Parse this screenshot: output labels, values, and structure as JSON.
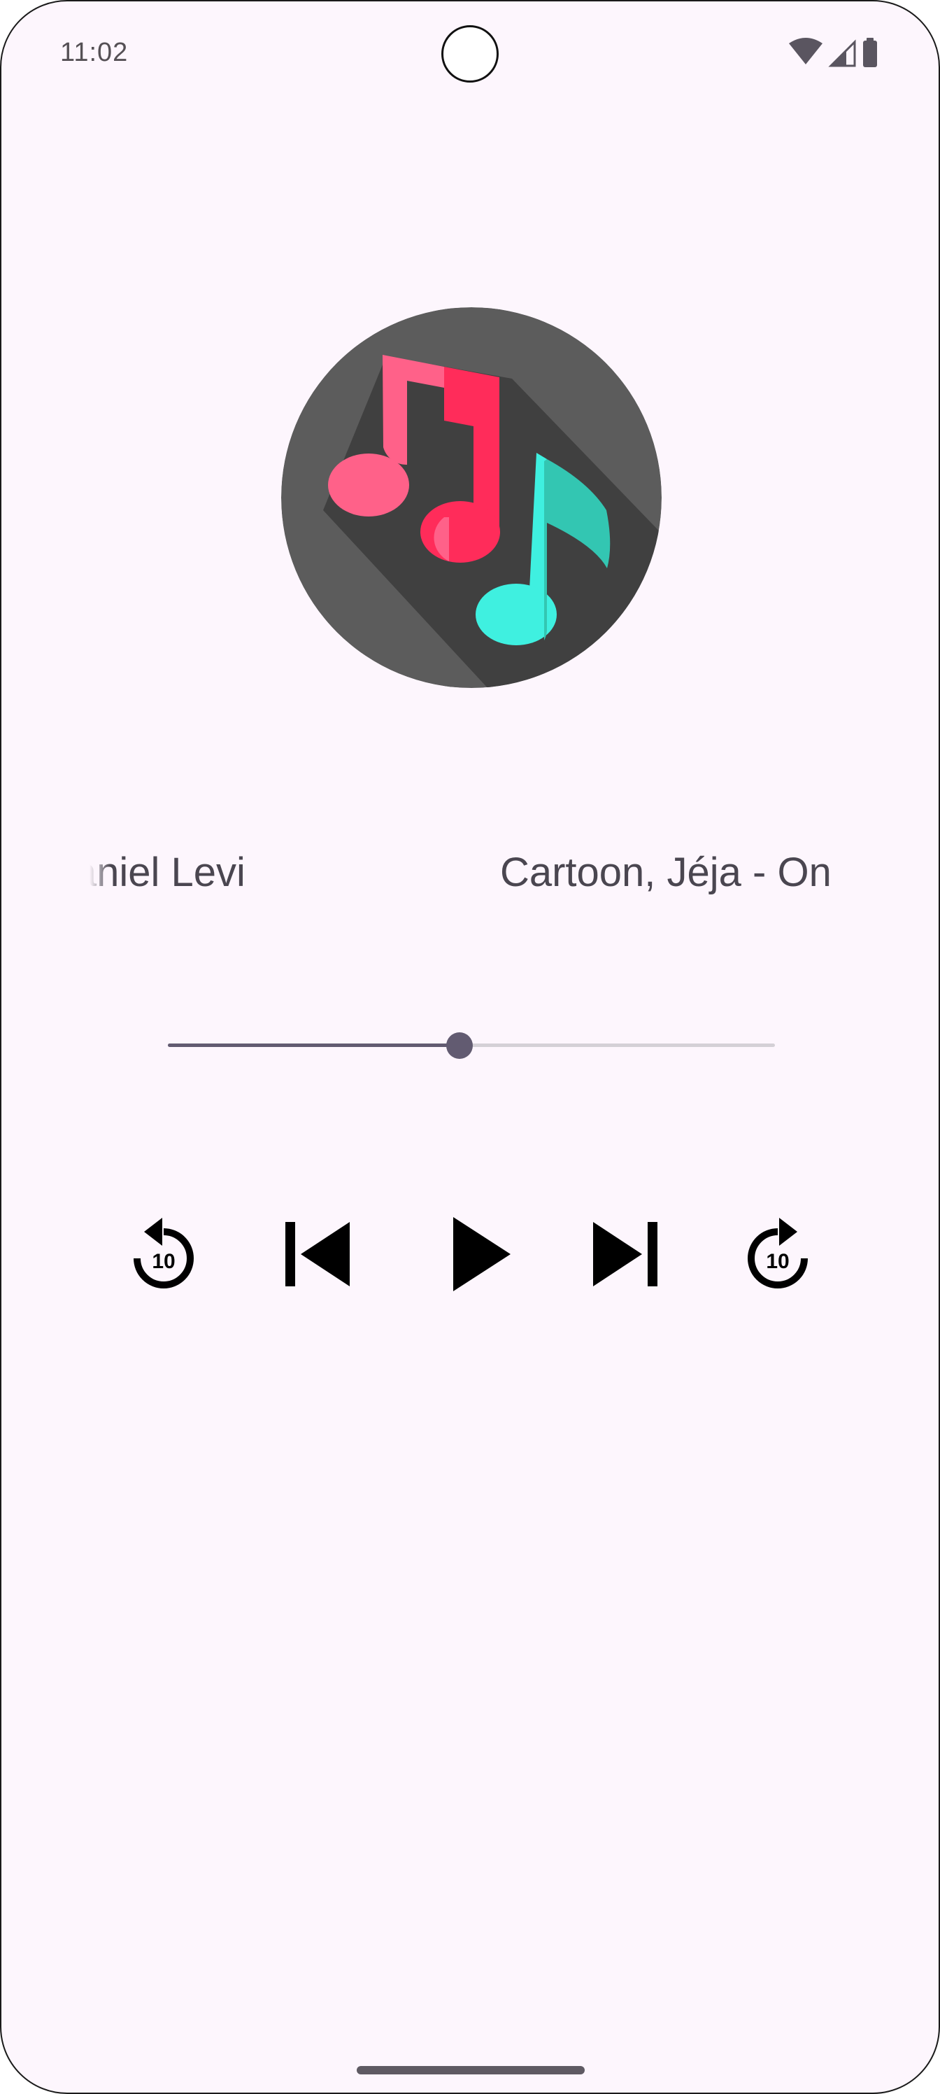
{
  "status_bar": {
    "time": "11:02",
    "icons": [
      "wifi-icon",
      "cellular-signal-icon",
      "battery-icon"
    ]
  },
  "player": {
    "album_art_icon": "music-notes-icon",
    "track_marquee": {
      "visible_start": "Daniel Levi",
      "visible_end": "Cartoon, Jéja - On"
    },
    "progress_fraction": 0.48,
    "controls": [
      {
        "icon": "replay-10-icon",
        "label": "10"
      },
      {
        "icon": "skip-previous-icon"
      },
      {
        "icon": "play-icon"
      },
      {
        "icon": "skip-next-icon"
      },
      {
        "icon": "forward-10-icon",
        "label": "10"
      }
    ]
  },
  "colors": {
    "background": "#fdf6fd",
    "accent": "#625b71",
    "track_inactive": "#d4d0d6",
    "album_bg": "#5c5c5c",
    "note_pink": "#ff2c5a",
    "note_teal": "#3ff0e0"
  }
}
